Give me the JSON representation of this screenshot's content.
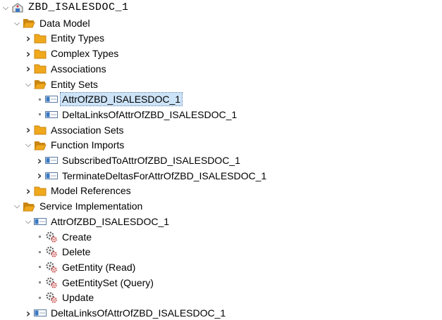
{
  "tree": [
    {
      "label": "ZBD_ISALESDOC_1",
      "level": 0,
      "toggle": "expanded",
      "icon": "project-icon",
      "mono": true
    },
    {
      "label": "Data Model",
      "level": 1,
      "toggle": "expanded",
      "icon": "folder-open-icon"
    },
    {
      "label": "Entity Types",
      "level": 2,
      "toggle": "collapsed",
      "icon": "folder-icon"
    },
    {
      "label": "Complex Types",
      "level": 2,
      "toggle": "collapsed",
      "icon": "folder-icon"
    },
    {
      "label": "Associations",
      "level": 2,
      "toggle": "collapsed",
      "icon": "folder-icon"
    },
    {
      "label": "Entity Sets",
      "level": 2,
      "toggle": "expanded",
      "icon": "folder-open-icon"
    },
    {
      "label": "AttrOfZBD_ISALESDOC_1",
      "level": 3,
      "toggle": "leaf",
      "icon": "entity-set-icon",
      "selected": true
    },
    {
      "label": "DeltaLinksOfAttrOfZBD_ISALESDOC_1",
      "level": 3,
      "toggle": "leaf",
      "icon": "entity-set-icon"
    },
    {
      "label": "Association Sets",
      "level": 2,
      "toggle": "collapsed",
      "icon": "folder-icon"
    },
    {
      "label": "Function Imports",
      "level": 2,
      "toggle": "expanded",
      "icon": "folder-open-icon"
    },
    {
      "label": "SubscribedToAttrOfZBD_ISALESDOC_1",
      "level": 3,
      "toggle": "collapsed",
      "icon": "entity-set-icon"
    },
    {
      "label": "TerminateDeltasForAttrOfZBD_ISALESDOC_1",
      "level": 3,
      "toggle": "collapsed",
      "icon": "entity-set-icon"
    },
    {
      "label": "Model References",
      "level": 2,
      "toggle": "collapsed",
      "icon": "folder-icon"
    },
    {
      "label": "Service Implementation",
      "level": 1,
      "toggle": "expanded",
      "icon": "folder-open-icon"
    },
    {
      "label": "AttrOfZBD_ISALESDOC_1",
      "level": 2,
      "toggle": "expanded",
      "icon": "entity-set-icon"
    },
    {
      "label": "Create",
      "level": 3,
      "toggle": "leaf",
      "icon": "operation-icon"
    },
    {
      "label": "Delete",
      "level": 3,
      "toggle": "leaf",
      "icon": "operation-icon"
    },
    {
      "label": "GetEntity (Read)",
      "level": 3,
      "toggle": "leaf",
      "icon": "operation-icon"
    },
    {
      "label": "GetEntitySet (Query)",
      "level": 3,
      "toggle": "leaf",
      "icon": "operation-icon"
    },
    {
      "label": "Update",
      "level": 3,
      "toggle": "leaf",
      "icon": "operation-icon"
    },
    {
      "label": "DeltaLinksOfAttrOfZBD_ISALESDOC_1",
      "level": 2,
      "toggle": "collapsed",
      "icon": "entity-set-icon"
    }
  ],
  "colors": {
    "folder": "#f0a81c",
    "folder_dark": "#c98610",
    "entity_set": "#3a78c2",
    "operation_red": "#c43a3a",
    "selection_bg": "#cde3f7"
  }
}
